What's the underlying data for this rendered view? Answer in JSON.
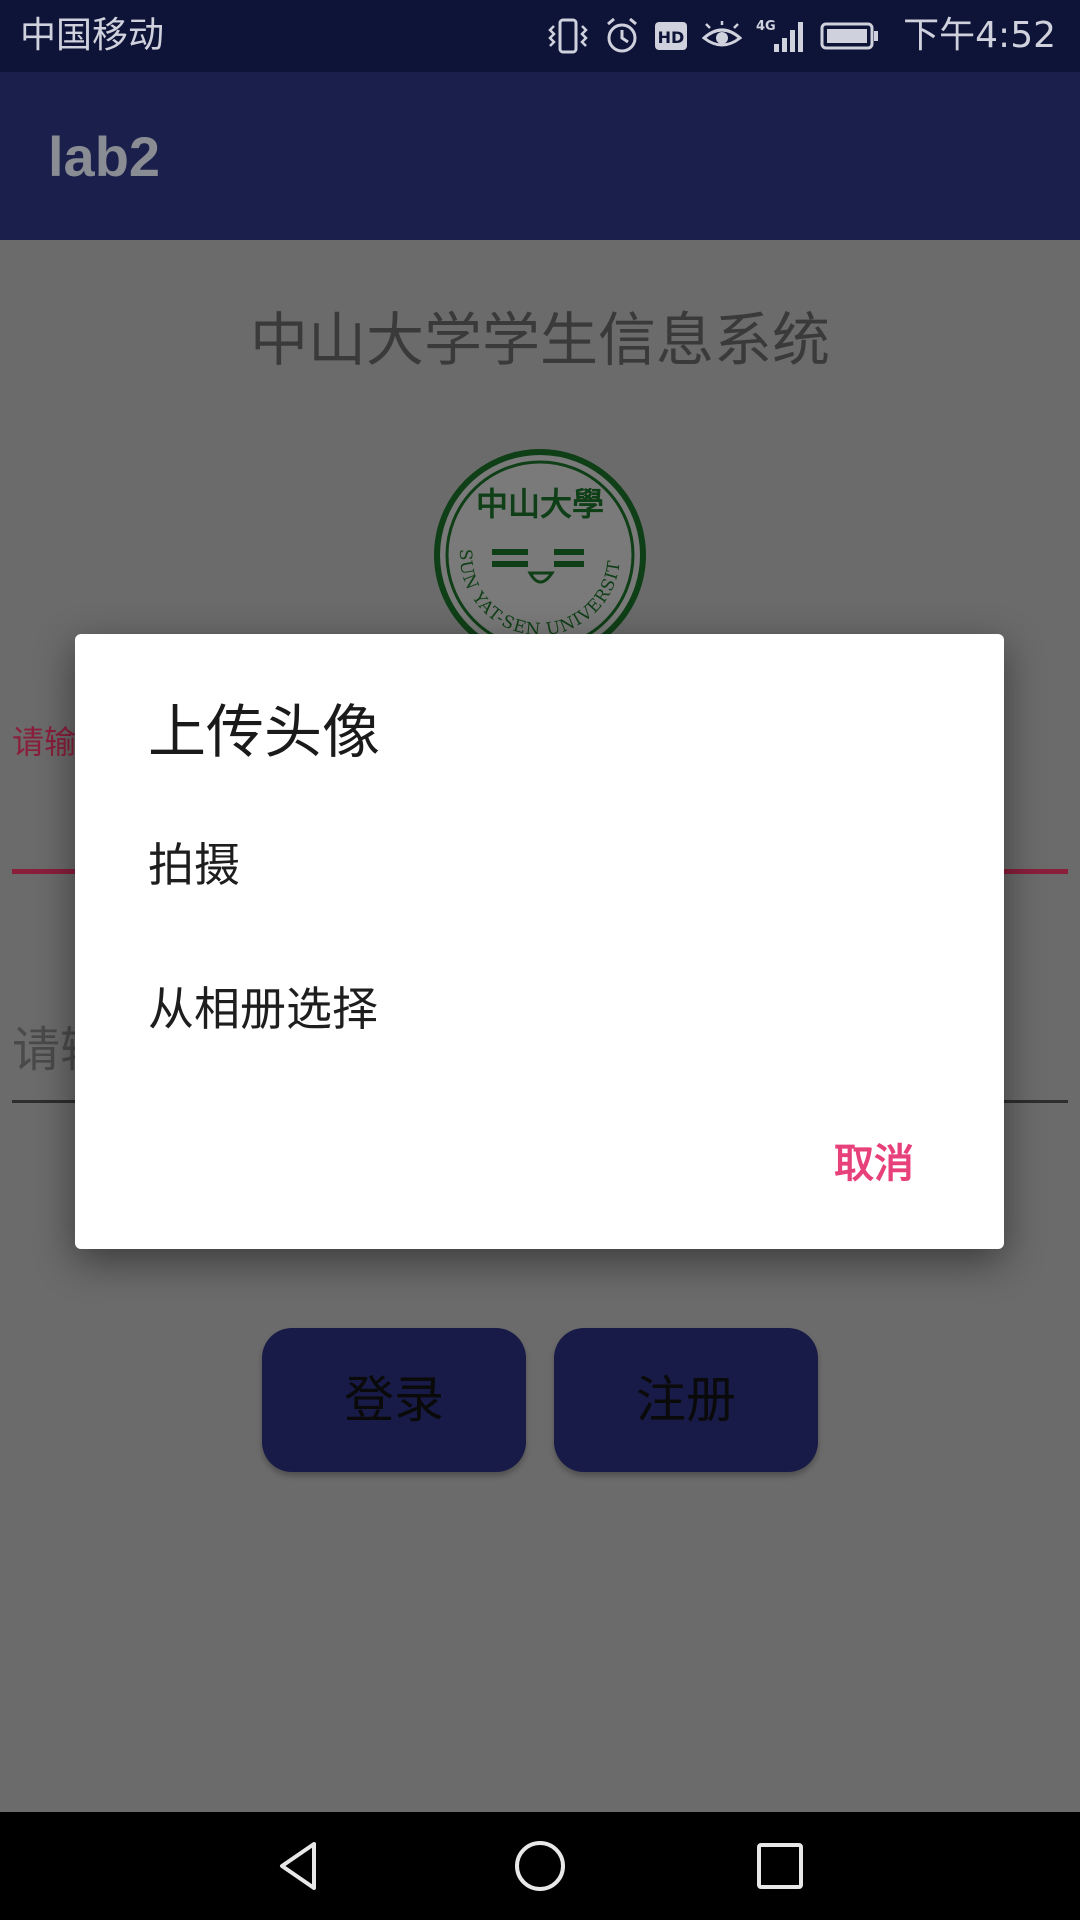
{
  "status_bar": {
    "carrier": "中国移动",
    "time": "下午4:52",
    "icons": [
      "vibrate-icon",
      "alarm-icon",
      "hd-icon",
      "eye-icon",
      "signal-4g-icon",
      "battery-icon"
    ],
    "network_label": "4G",
    "hd_label": "HD"
  },
  "app_bar": {
    "title": "lab2"
  },
  "page": {
    "system_title": "中山大学学生信息系统",
    "logo": {
      "text_top": "中山大學",
      "text_ring": "SUN YAT-SEN UNIVERSITY"
    },
    "username_hint": "请输",
    "password_hint": "请输",
    "login_label": "登录",
    "register_label": "注册"
  },
  "dialog": {
    "title": "上传头像",
    "items": [
      {
        "label": "拍摄"
      },
      {
        "label": "从相册选择"
      }
    ],
    "cancel_label": "取消"
  },
  "colors": {
    "status_bar": "#0e1338",
    "app_bar": "#1b1f4b",
    "scrim_bg": "#6b6b6b",
    "accent": "#e8407a",
    "button_bg": "#181b47"
  },
  "nav_bar": {
    "icons": [
      "back-icon",
      "home-icon",
      "recents-icon"
    ]
  }
}
